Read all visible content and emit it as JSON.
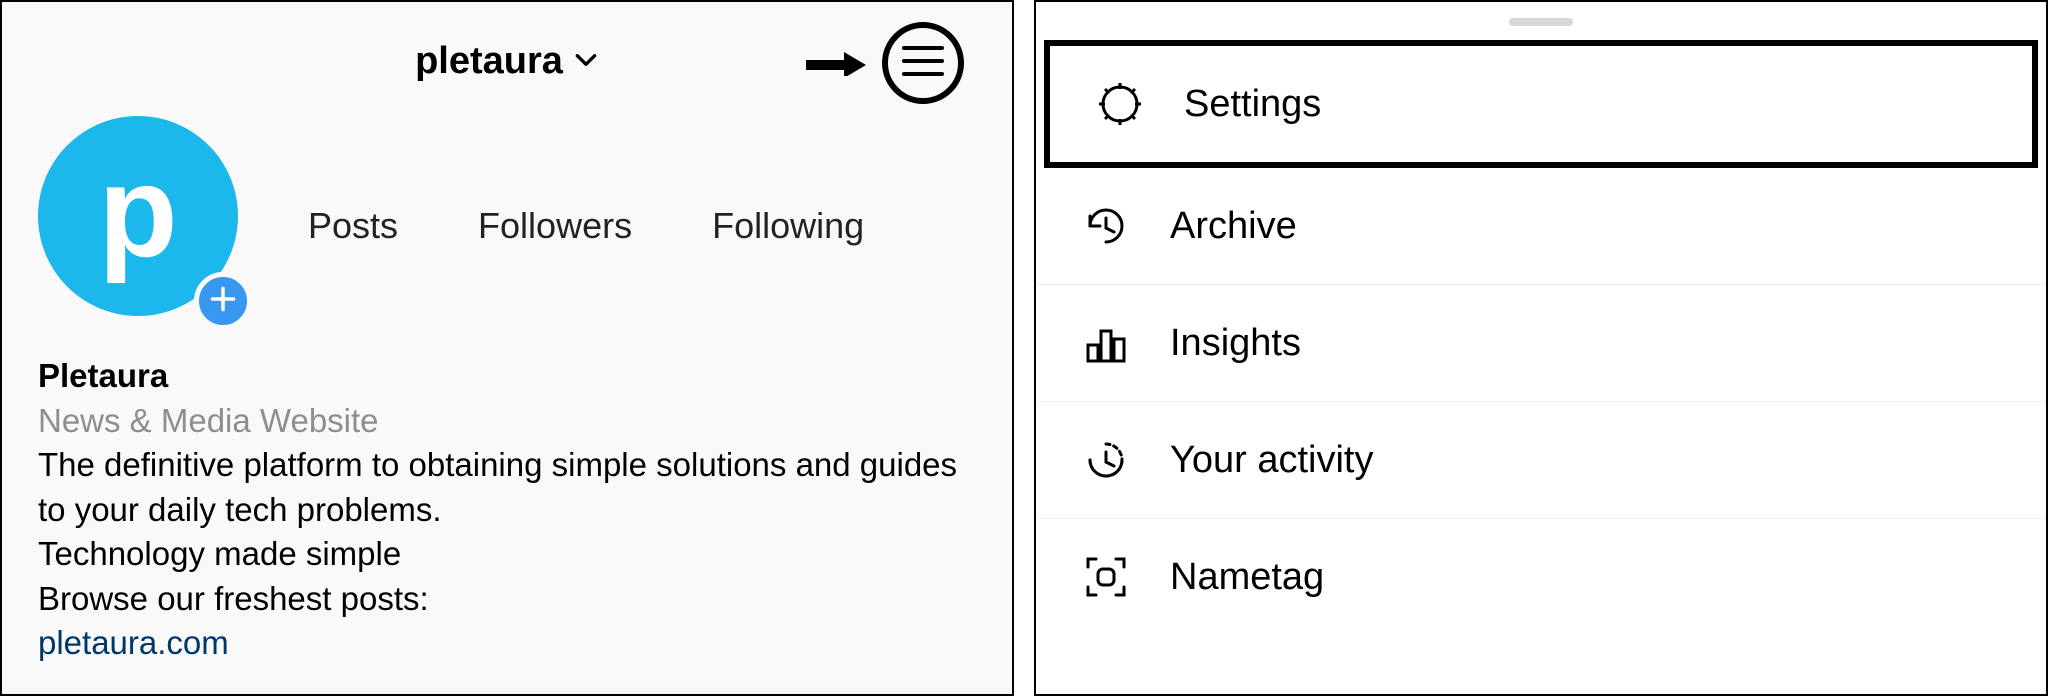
{
  "profile": {
    "username": "pletaura",
    "avatar_letter": "p",
    "stats": {
      "posts": "Posts",
      "followers": "Followers",
      "following": "Following"
    },
    "bio": {
      "name": "Pletaura",
      "category": "News & Media Website",
      "line1": "The definitive platform to obtaining simple solutions and guides to your daily tech problems.",
      "line2": "Technology made simple",
      "line3": "Browse our freshest posts:",
      "link": "pletaura.com"
    }
  },
  "menu": {
    "settings": "Settings",
    "archive": "Archive",
    "insights": "Insights",
    "activity": "Your activity",
    "nametag": "Nametag"
  }
}
